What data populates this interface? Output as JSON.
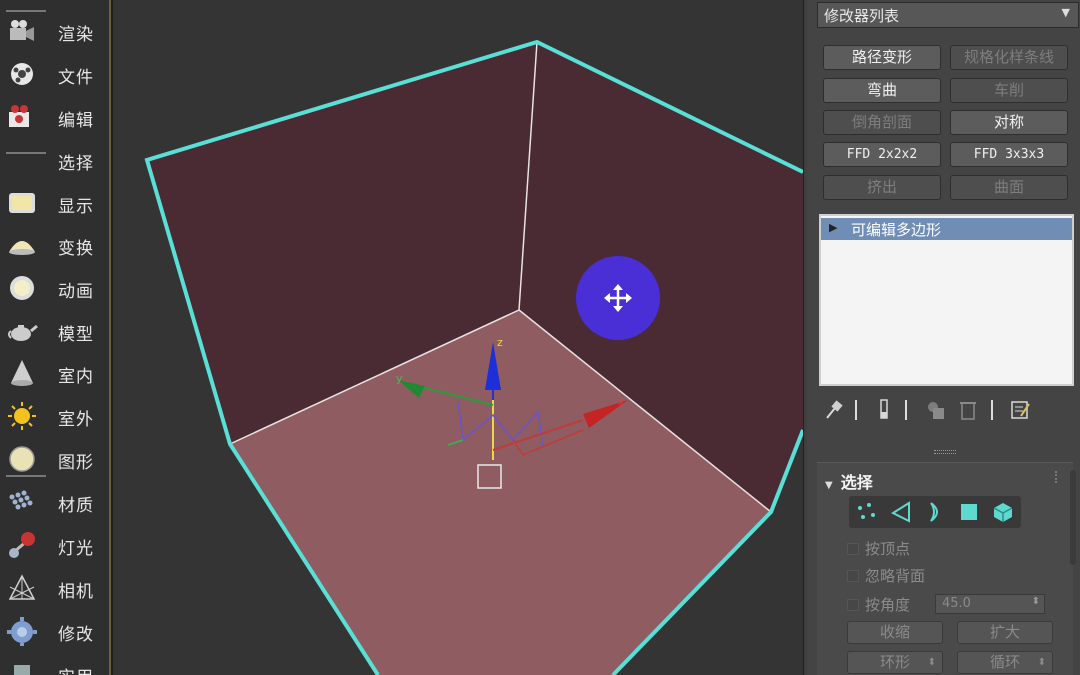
{
  "left_toolbar": {
    "items": [
      {
        "label": "渲染",
        "icon": "movie-camera-icon"
      },
      {
        "label": "文件",
        "icon": "film-reel-icon"
      },
      {
        "label": "编辑",
        "icon": "video-camera-icon"
      },
      {
        "label": "选择",
        "icon": "selection-icon"
      },
      {
        "label": "显示",
        "icon": "display-monitor-icon"
      },
      {
        "label": "变换",
        "icon": "hemisphere-icon"
      },
      {
        "label": "动画",
        "icon": "ring-sphere-icon"
      },
      {
        "label": "模型",
        "icon": "teapot-icon"
      },
      {
        "label": "室内",
        "icon": "cone-light-icon"
      },
      {
        "label": "室外",
        "icon": "sun-icon"
      },
      {
        "label": "图形",
        "icon": "disc-icon"
      },
      {
        "label": "材质",
        "icon": "material-grid-icon"
      },
      {
        "label": "灯光",
        "icon": "omni-light-icon"
      },
      {
        "label": "相机",
        "icon": "camera-frustum-icon"
      },
      {
        "label": "修改",
        "icon": "gear-cog-icon"
      },
      {
        "label": "实用",
        "icon": "utility-icon"
      }
    ]
  },
  "viewport": {
    "gizmo_axes": [
      "z",
      "y",
      "x"
    ],
    "move_cursor": "move-arrows-icon",
    "colors": {
      "background": "#343434",
      "back_wall": "#4a2a33",
      "floor": "#8f5c62",
      "selection_outline": "#59e0d6",
      "cursor_circle": "#4b2fd6"
    }
  },
  "modifier_panel": {
    "dropdown_label": "修改器列表",
    "buttons": [
      {
        "label": "路径变形",
        "enabled": true
      },
      {
        "label": "规格化样条线",
        "enabled": false
      },
      {
        "label": "弯曲",
        "enabled": true
      },
      {
        "label": "车削",
        "enabled": false
      },
      {
        "label": "倒角剖面",
        "enabled": false
      },
      {
        "label": "对称",
        "enabled": true
      },
      {
        "label": "FFD 2x2x2",
        "enabled": true
      },
      {
        "label": "FFD 3x3x3",
        "enabled": true
      },
      {
        "label": "挤出",
        "enabled": false
      },
      {
        "label": "曲面",
        "enabled": false
      }
    ],
    "stack": [
      {
        "label": "可编辑多边形",
        "selected": true
      }
    ],
    "stack_tools": [
      "pin-stack-icon",
      "show-end-result-icon",
      "make-unique-icon",
      "remove-modifier-icon",
      "configure-sets-icon"
    ]
  },
  "selection_rollout": {
    "title": "选择",
    "subobject_icons": [
      "vertex-icon",
      "edge-icon",
      "border-icon",
      "polygon-icon",
      "element-icon"
    ],
    "options": {
      "by_vertex": "按顶点",
      "ignore_backfacing": "忽略背面",
      "by_angle": "按角度",
      "angle_value": "45.0"
    },
    "buttons": {
      "shrink": "收缩",
      "grow": "扩大",
      "ring": "环形",
      "loop": "循环"
    }
  }
}
